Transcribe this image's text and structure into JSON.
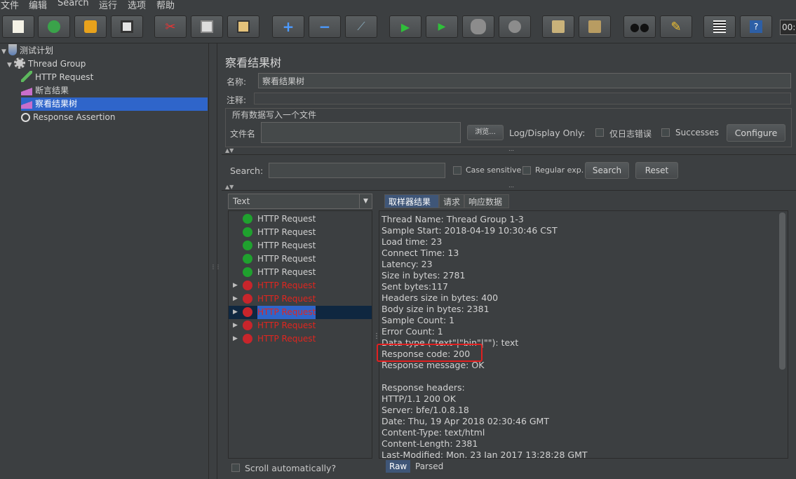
{
  "menu": [
    "文件",
    "编辑",
    "Search",
    "运行",
    "选项",
    "帮助"
  ],
  "toolbar": {
    "icons": [
      "new-icon",
      "templates-icon",
      "open-icon",
      "save-icon",
      "cut-icon",
      "copy-icon",
      "paste-icon",
      "expand-icon",
      "collapse-icon",
      "toggle-icon",
      "start-icon",
      "start-no-pause-icon",
      "stop-icon",
      "shutdown-icon",
      "clear-icon",
      "clear-all-icon",
      "search-icon",
      "reset-search-icon",
      "function-helper-icon",
      "help-icon"
    ],
    "timer": "00:"
  },
  "tree": {
    "items": [
      {
        "label": "测试计划",
        "icon": "test-plan-icon"
      },
      {
        "label": "Thread Group",
        "icon": "gear-icon"
      },
      {
        "label": "HTTP Request",
        "icon": "pipette-icon"
      },
      {
        "label": "断言结果",
        "icon": "chart-icon"
      },
      {
        "label": "察看结果树",
        "icon": "chart-icon"
      },
      {
        "label": "Response Assertion",
        "icon": "magnifier-icon"
      }
    ]
  },
  "panel": {
    "title": "察看结果树",
    "name_label": "名称:",
    "name_value": "察看结果树",
    "comment_label": "注释:",
    "fieldset_legend": "所有数据写入一个文件",
    "file_label": "文件名",
    "browse": "浏览...",
    "log_display": "Log/Display Only:",
    "errors_only": "仅日志错误",
    "successes": "Successes",
    "configure": "Configure"
  },
  "search": {
    "label": "Search:",
    "case_sensitive": "Case sensitive",
    "regular_exp": "Regular exp.",
    "search_btn": "Search",
    "reset_btn": "Reset"
  },
  "results": {
    "renderer": "Text",
    "items": [
      {
        "label": "HTTP Request",
        "status": "ok"
      },
      {
        "label": "HTTP Request",
        "status": "ok"
      },
      {
        "label": "HTTP Request",
        "status": "ok"
      },
      {
        "label": "HTTP Request",
        "status": "ok"
      },
      {
        "label": "HTTP Request",
        "status": "ok"
      },
      {
        "label": "HTTP Request",
        "status": "error"
      },
      {
        "label": "HTTP Request",
        "status": "error"
      },
      {
        "label": "HTTP Request",
        "status": "error"
      },
      {
        "label": "HTTP Request",
        "status": "error"
      },
      {
        "label": "HTTP Request",
        "status": "error"
      }
    ],
    "scroll_auto": "Scroll automatically?"
  },
  "detail": {
    "tabs": [
      "取样器结果",
      "请求",
      "响应数据"
    ],
    "lines": [
      "Thread Name: Thread Group 1-3",
      "Sample Start: 2018-04-19 10:30:46 CST",
      "Load time: 23",
      "Connect Time: 13",
      "Latency: 23",
      "Size in bytes: 2781",
      "Sent bytes:117",
      "Headers size in bytes: 400",
      "Body size in bytes: 2381",
      "Sample Count: 1",
      "Error Count: 1",
      "Data type (\"text\"|\"bin\"|\"\"): text",
      "Response code: 200",
      "Response message: OK",
      "",
      "Response headers:",
      "HTTP/1.1 200 OK",
      "Server: bfe/1.0.8.18",
      "Date: Thu, 19 Apr 2018 02:30:46 GMT",
      "Content-Type: text/html",
      "Content-Length: 2381",
      "Last-Modified: Mon, 23 Jan 2017 13:28:28 GMT"
    ],
    "bottom_tabs": [
      "Raw",
      "Parsed"
    ]
  },
  "colors": {
    "selection": "#2f65ca",
    "error_text": "#e0261f",
    "highlight_box": "#e02020"
  }
}
